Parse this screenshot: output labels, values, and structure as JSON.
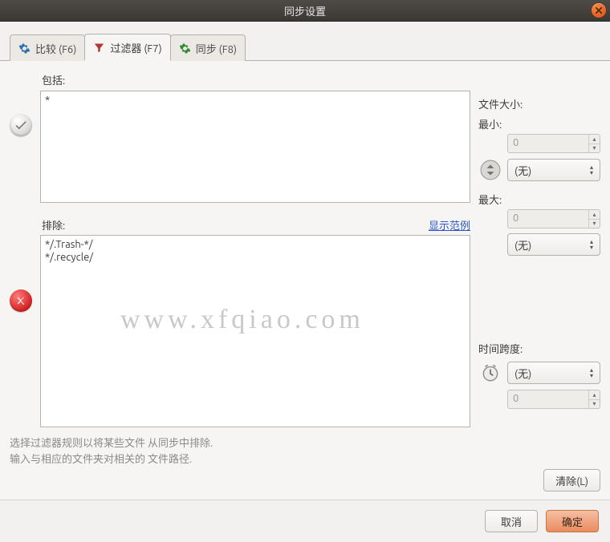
{
  "title": "同步设置",
  "tabs": [
    {
      "label": "比较 (F6)"
    },
    {
      "label": "过滤器 (F7)"
    },
    {
      "label": "同步 (F8)"
    }
  ],
  "filter": {
    "include_label": "包括:",
    "include_value": "*",
    "exclude_label": "排除:",
    "show_example": "显示范例",
    "exclude_value": "*/.Trash-*/\n*/.recycle/",
    "hint_line1": "选择过滤器规则以将某些文件 从同步中排除.",
    "hint_line2": "输入与相应的文件夹对相关的 文件路径."
  },
  "filesize": {
    "label": "文件大小:",
    "min_label": "最小:",
    "min_value": "0",
    "min_unit": "(无)",
    "max_label": "最大:",
    "max_value": "0",
    "max_unit": "(无)"
  },
  "timespan": {
    "label": "时间跨度:",
    "unit": "(无)",
    "value": "0"
  },
  "buttons": {
    "clear": "清除(L)",
    "cancel": "取消",
    "ok": "确定"
  },
  "watermark": "www.xfqiao.com"
}
